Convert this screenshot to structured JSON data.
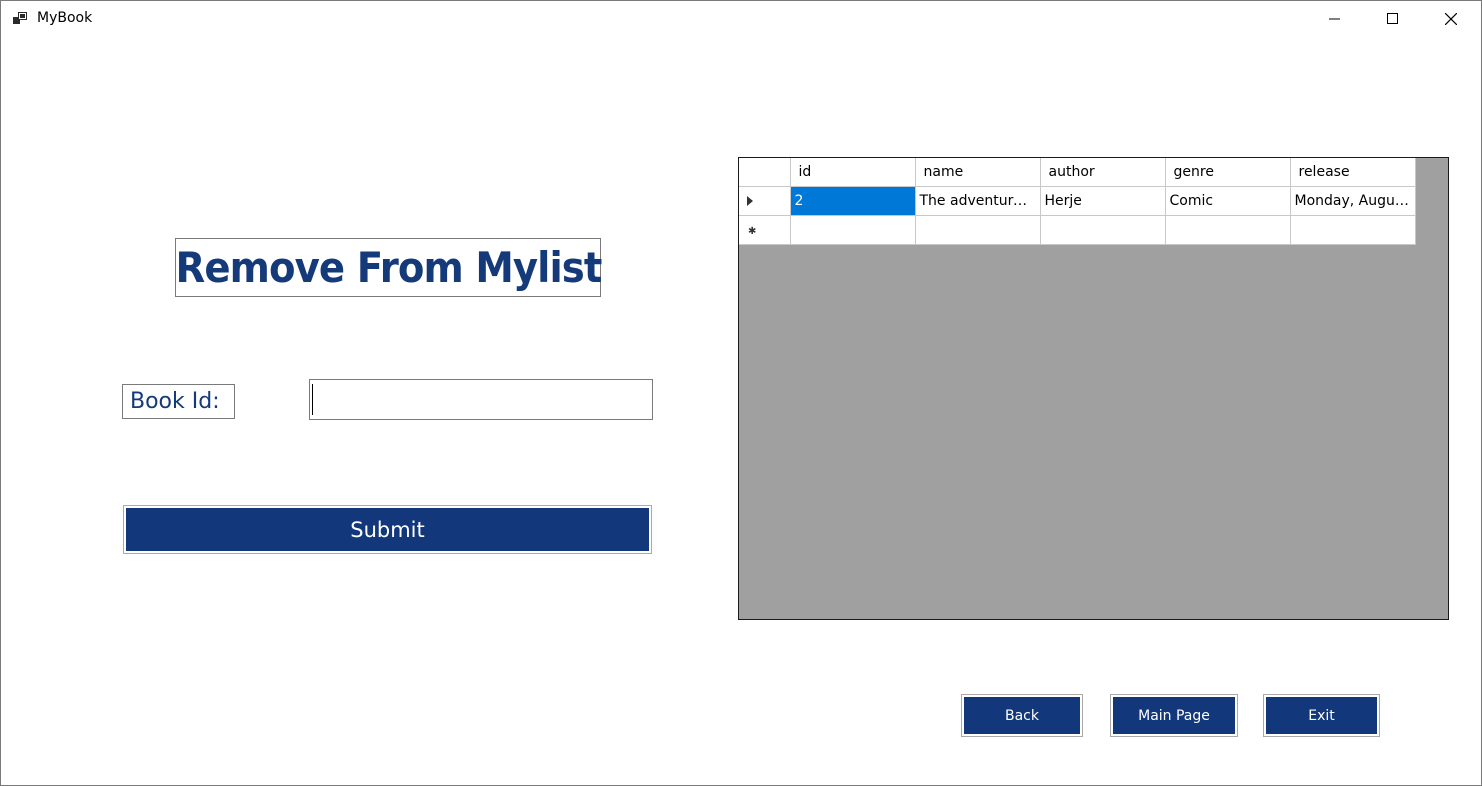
{
  "window": {
    "title": "MyBook"
  },
  "form": {
    "heading": "Remove From Mylist",
    "book_id_label": "Book Id:",
    "book_id_value": "",
    "submit_label": "Submit"
  },
  "grid": {
    "columns": [
      "id",
      "name",
      "author",
      "genre",
      "release"
    ],
    "rows": [
      [
        "2",
        "The adventure ...",
        "Herje",
        "Comic",
        "Monday, Augus..."
      ]
    ]
  },
  "nav": {
    "back_label": "Back",
    "main_page_label": "Main Page",
    "exit_label": "Exit"
  },
  "colors": {
    "accent": "#12377a",
    "selection": "#0078d7",
    "grid_background": "#a0a0a0"
  }
}
